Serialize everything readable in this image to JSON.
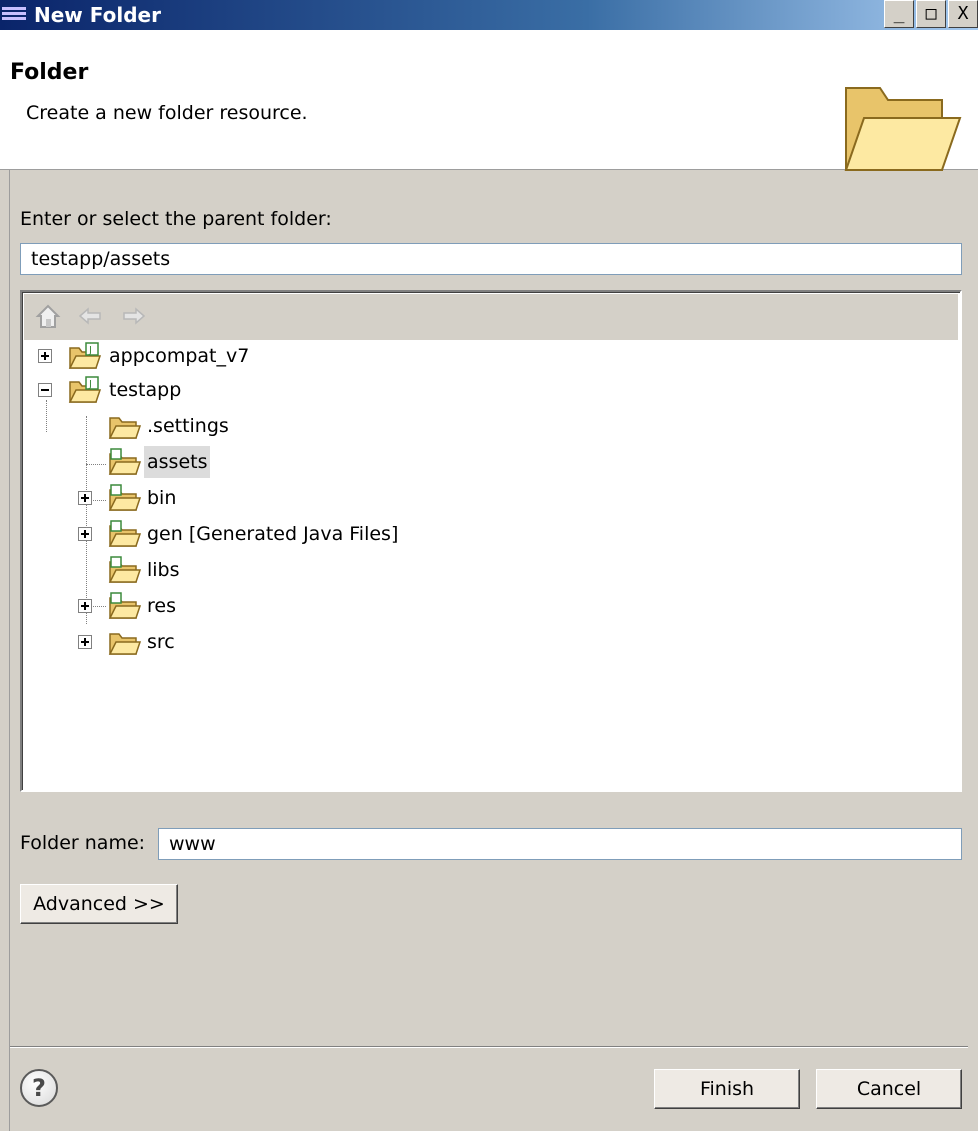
{
  "window": {
    "title": "New Folder",
    "min_label": "_",
    "max_label": "□",
    "close_label": "X"
  },
  "header": {
    "title": "Folder",
    "description": "Create a new folder resource."
  },
  "parent": {
    "label": "Enter or select the parent folder:",
    "value": "testapp/assets"
  },
  "tree": {
    "items": [
      {
        "label": "appcompat_v7",
        "expander": "+",
        "icon": "project-folder-icon"
      },
      {
        "label": "testapp",
        "expander": "-",
        "icon": "project-folder-icon"
      },
      {
        "label": ".settings",
        "icon": "folder-icon"
      },
      {
        "label": "assets",
        "icon": "source-folder-icon",
        "selected": true
      },
      {
        "label": "bin",
        "expander": "+",
        "icon": "source-folder-icon"
      },
      {
        "label": "gen [Generated Java Files]",
        "expander": "+",
        "icon": "source-folder-icon"
      },
      {
        "label": "libs",
        "icon": "source-folder-icon"
      },
      {
        "label": "res",
        "expander": "+",
        "icon": "source-folder-icon"
      },
      {
        "label": "src",
        "expander": "+",
        "icon": "folder-icon"
      }
    ]
  },
  "folder_name": {
    "label": "Folder name:",
    "value": "www"
  },
  "buttons": {
    "advanced": "Advanced >>",
    "finish": "Finish",
    "cancel": "Cancel",
    "help": "?"
  }
}
